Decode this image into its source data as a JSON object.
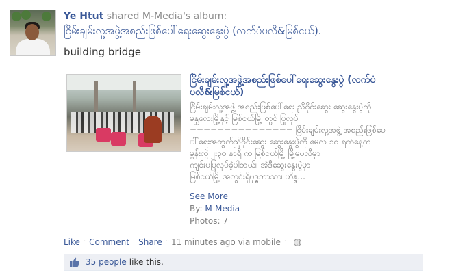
{
  "story": {
    "author": "Ye Htut",
    "action_text": "shared M-Media's album:",
    "album_name": "ငြိမ်းချမ်းလူ့အဖွဲ့အစည်းဖြစ်ပေါ်ရေးဆွေးနွေးပွဲ (လက်ပံပလီ&မြစ်ငယ်).",
    "message": "building bridge"
  },
  "attachment": {
    "title": "ငြိမ်းချမ်းလူ့အဖွဲ့အစည်းဖြစ်ပေါ်ရေးဆွေးနွေးပွဲ (လက်ပံပလီ&မြစ်ငယ်)",
    "description_lines": [
      "ငြိမ်းချမ်းလူ့အဖွဲ့ အစည်းဖြစ်ပေါ်ရေး ညှိဝိုင်းဆွေး ဆွေးနွေးပွဲကို",
      "မန္တလေးမြို့နှင့် မြစ်ငယ်မြို့ တွင် ပြုလုပ်",
      "=============== ငြိမ်းချမ်းလူ့အဖွဲ့ အစည်းဖြစ်ပေ",
      "ါ်ရေးအတွက်ညှိဝိုင်းဆွေး ဆွေးနွေးပွဲကို မေလ ၁၀ ရက်နေ့က",
      "မွန်းလွဲ ၂း၃၀ နာရီ က မြစ်ငယ်မြို့ မြို့မပလီမှာ",
      "ကျင်းပပြုလုပ်ခဲ့ပါတယ်။ အဲဒီဆွေးနွေးပွဲမှာ",
      "မြစ်ငယ်မြို့ အတွင်းရှိဗုဒ္ဓဘာသာ၊ ဟိန္ဒ..."
    ],
    "see_more": "See More",
    "by_label": "By:",
    "by_name": "M-Media",
    "photos_label": "Photos:",
    "photos_count": "7"
  },
  "actions": {
    "like": "Like",
    "comment": "Comment",
    "share": "Share",
    "time": "11 minutes ago",
    "via": "via mobile",
    "separator": "·"
  },
  "likes": {
    "count_text": "35 people",
    "suffix": "like this."
  },
  "colors": {
    "link": "#3b5998",
    "muted": "#808080",
    "likes_bg": "#edeff4"
  },
  "icons": [
    "avatar-photo",
    "album-thumbnail",
    "globe-icon",
    "thumbs-up-icon"
  ]
}
